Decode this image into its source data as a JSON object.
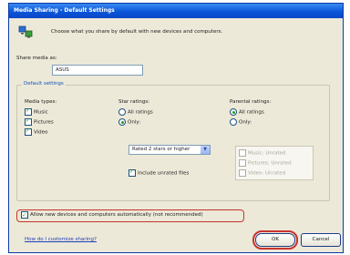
{
  "window": {
    "title": "Media Sharing - Default Settings"
  },
  "header": {
    "description": "Choose what you share by default with new devices and computers."
  },
  "share_media": {
    "label": "Share media as:",
    "value": "ASUS"
  },
  "default_settings": {
    "group_label": "Default settings",
    "media_types": {
      "label": "Media types:",
      "items": [
        {
          "label": "Music",
          "checked": true
        },
        {
          "label": "Pictures",
          "checked": true
        },
        {
          "label": "Video",
          "checked": true
        }
      ]
    },
    "star_ratings": {
      "label": "Star ratings:",
      "options": [
        {
          "label": "All ratings",
          "selected": false
        },
        {
          "label": "Only:",
          "selected": true
        }
      ],
      "dropdown_value": "Rated 2 stars or higher",
      "include_unrated": {
        "label": "Include unrated files",
        "checked": true
      }
    },
    "parental_ratings": {
      "label": "Parental ratings:",
      "options": [
        {
          "label": "All ratings",
          "selected": true
        },
        {
          "label": "Only:",
          "selected": false
        }
      ],
      "items": [
        {
          "label": "Music: Unrated",
          "checked": true
        },
        {
          "label": "Pictures: Unrated",
          "checked": true
        },
        {
          "label": "Video: Unrated",
          "checked": true
        }
      ]
    }
  },
  "allow_new_devices": {
    "label": "Allow new devices and computers automatically (not recommended)",
    "checked": true
  },
  "footer": {
    "help_link": "How do I customize sharing?",
    "ok_label": "OK",
    "cancel_label": "Cancel"
  },
  "colors": {
    "titlebar": "#0b55d9",
    "dialog_bg": "#ece9d8",
    "highlight_ring": "#c8332e"
  }
}
